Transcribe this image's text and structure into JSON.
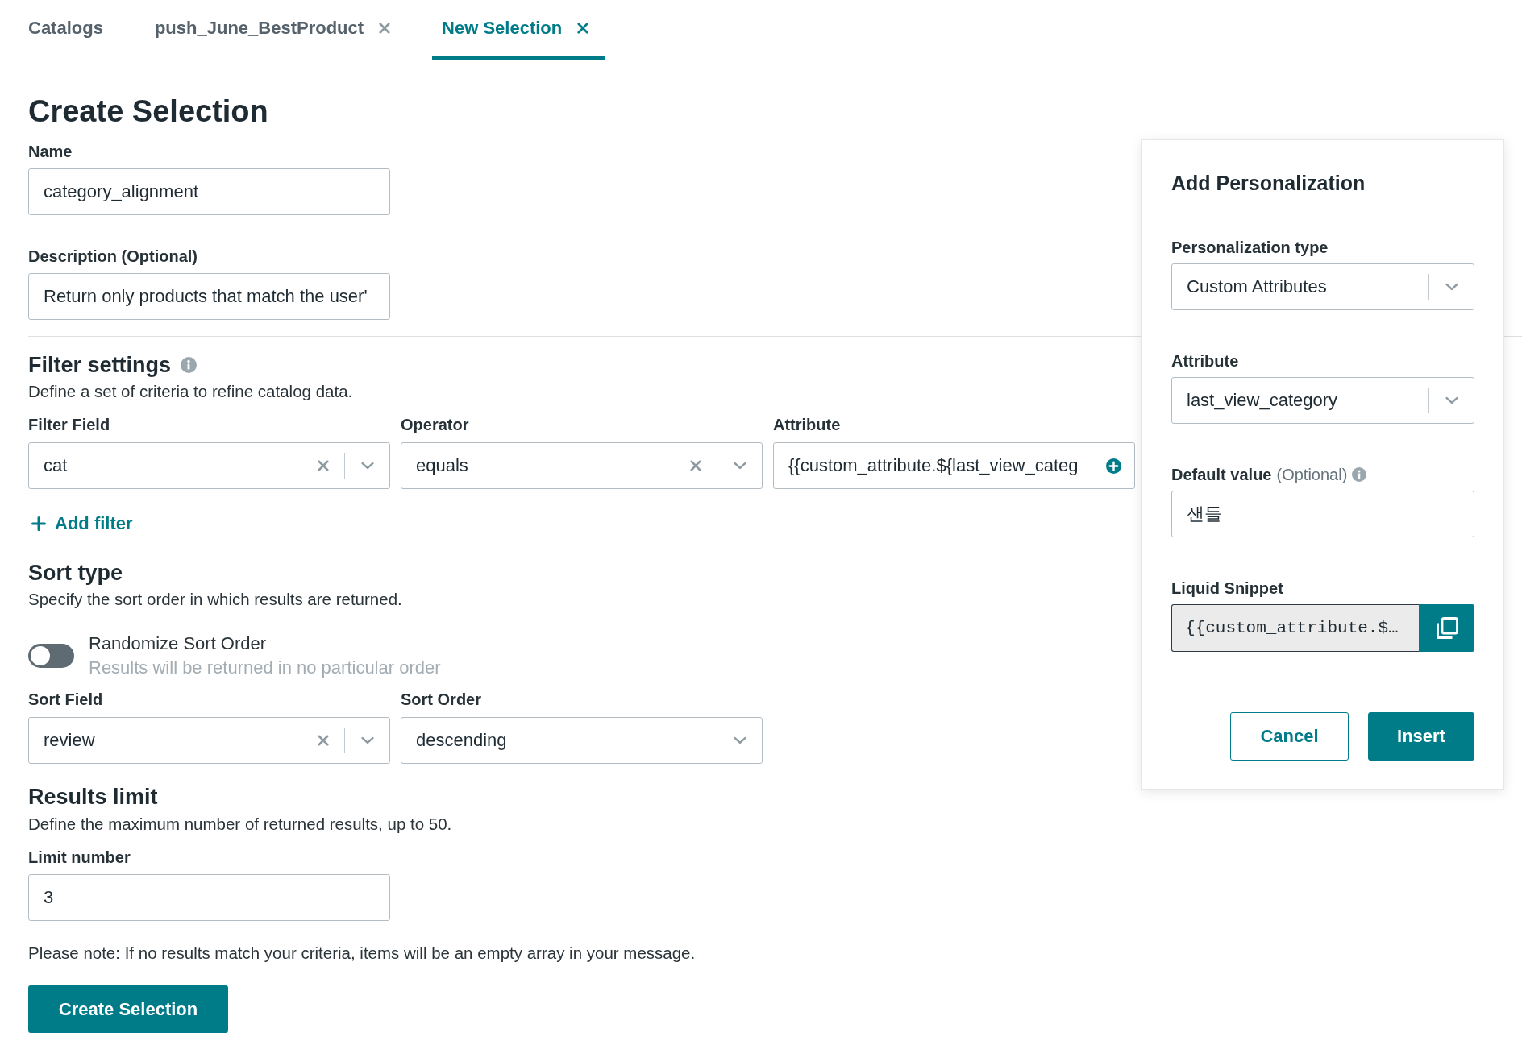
{
  "tabs": [
    {
      "label": "Catalogs",
      "closable": false,
      "selected": false
    },
    {
      "label": "push_June_BestProduct",
      "closable": true,
      "selected": false
    },
    {
      "label": "New Selection",
      "closable": true,
      "selected": true
    }
  ],
  "title": "Create Selection",
  "details": [
    {
      "label": "Name",
      "value": "category_alignment",
      "kind": "text"
    },
    {
      "label": "Description (Optional)",
      "value": "Return only products that match the user'",
      "kind": "text"
    }
  ],
  "filter_settings": {
    "title": "Filter settings",
    "description": "Define a set of criteria to refine catalog data.",
    "fields": [
      {
        "label": "Filter Field",
        "value": "cat",
        "kind": "clearable_select"
      },
      {
        "label": "Operator",
        "value": "equals",
        "kind": "clearable_select"
      },
      {
        "label": "Attribute",
        "value": "{{custom_attribute.${last_view_categ",
        "kind": "attribute_input"
      }
    ],
    "add_button": "Add filter"
  },
  "sort_type": {
    "title": "Sort type",
    "description": "Specify the sort order in which results are returned.",
    "randomize": {
      "label": "Randomize Sort Order",
      "hint": "Results will be returned in no particular order",
      "on": false
    },
    "fields": [
      {
        "label": "Sort Field",
        "value": "review",
        "kind": "clearable_select"
      },
      {
        "label": "Sort Order",
        "value": "descending",
        "kind": "select"
      }
    ]
  },
  "results_limit": {
    "title": "Results limit",
    "description": "Define the maximum number of returned results, up to 50.",
    "field": {
      "label": "Limit number",
      "value": "3",
      "kind": "text"
    }
  },
  "note": "Please note: If no results match your criteria, items will be an empty array in your message.",
  "submit_button": "Create Selection",
  "personalization_panel": {
    "title": "Add Personalization",
    "fields": [
      {
        "label": "Personalization type",
        "value": "Custom Attributes",
        "kind": "select",
        "info": false
      },
      {
        "label": "Attribute",
        "value": "last_view_category",
        "kind": "select",
        "info": false
      },
      {
        "label": "Default value",
        "optional": "(Optional)",
        "value": "샌들",
        "kind": "text",
        "info": true
      },
      {
        "label": "Liquid Snippet",
        "value": "{{custom_attribute.$…",
        "kind": "snippet",
        "info": false
      }
    ],
    "buttons": [
      {
        "label": "Cancel",
        "kind": "secondary"
      },
      {
        "label": "Insert",
        "kind": "primary"
      }
    ]
  }
}
